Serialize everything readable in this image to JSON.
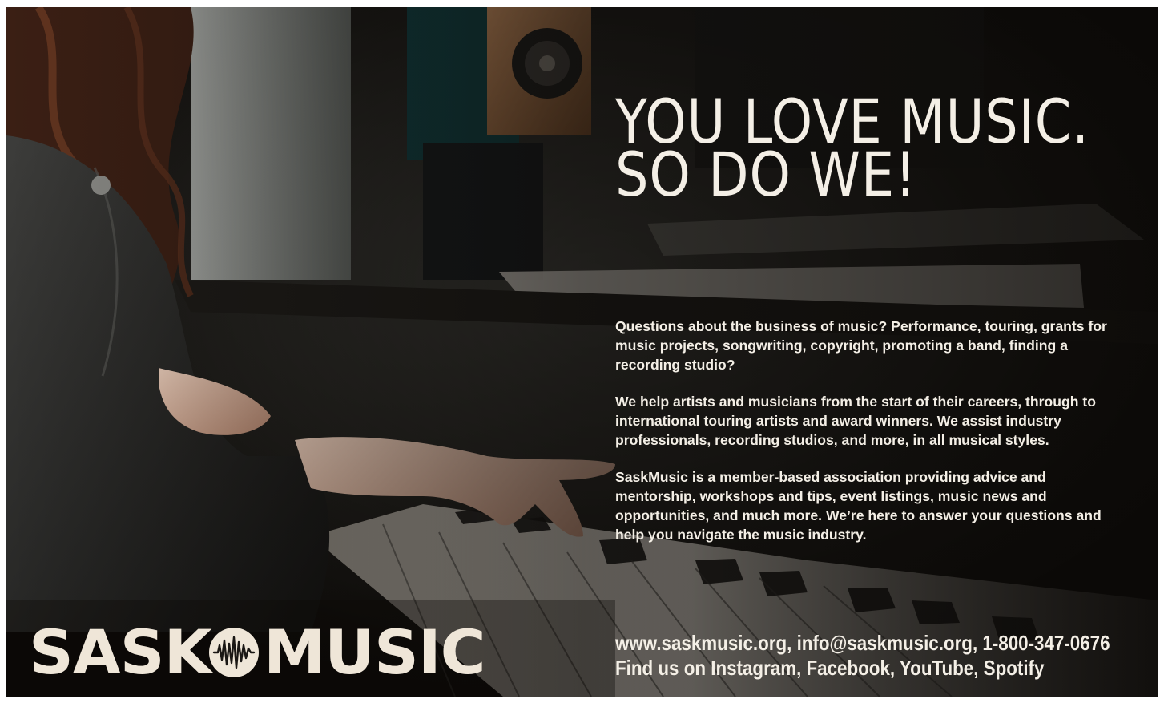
{
  "headline": {
    "line1": "YOU LOVE MUSIC.",
    "line2": "SO DO WE!"
  },
  "body": {
    "paragraph1": "Questions about the business of music? Performance, touring, grants for music projects, songwriting, copyright, promoting a band, finding a recording studio?",
    "paragraph2": "We help artists and musicians from the start of their careers, through to international touring artists and award winners. We assist industry professionals, recording studios, and more, in all musical styles.",
    "paragraph3": "SaskMusic is a member-based association providing advice and mentorship, workshops and tips, event listings, music news and opportunities, and much more. We’re here to answer your questions and help you navigate the music industry."
  },
  "contact": {
    "line1": "www.saskmusic.org, info@saskmusic.org, 1-800-347-0676",
    "line2": "Find us on Instagram, Facebook, YouTube, Spotify"
  },
  "logo": {
    "left_word": "SASK",
    "right_word": "MUSIC",
    "emblem_icon": "sound-wave-emblem-icon"
  },
  "colors": {
    "text": "#f4efe6",
    "logo": "#efe6d8",
    "background": "#0b0907"
  }
}
